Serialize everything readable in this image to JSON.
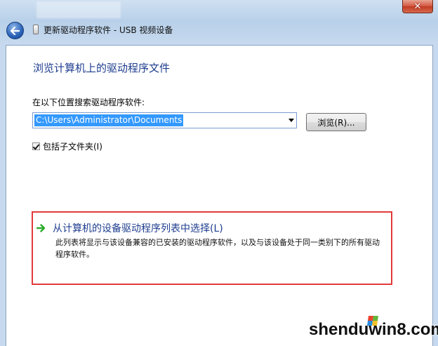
{
  "window": {
    "title": "更新驱动程序软件 - USB 视频设备",
    "close_symbol": "✕"
  },
  "icons": {
    "back": "back-arrow-icon",
    "device": "usb-device-icon",
    "choose": "green-arrow-icon"
  },
  "content": {
    "heading": "浏览计算机上的驱动程序文件",
    "search_label": "在以下位置搜索驱动程序软件:",
    "path_value": "C:\\Users\\Administrator\\Documents",
    "browse_label": "浏览(R)...",
    "include_subfolders_label": "包括子文件夹(I)",
    "include_subfolders_checked": true,
    "choose_link": "从计算机的设备驱动程序列表中选择(L)",
    "choose_desc": "此列表将显示与该设备兼容的已安装的驱动程序软件，以及与该设备处于同一类别下的所有驱动程序软件。"
  },
  "colors": {
    "link_blue": "#1e3d8f",
    "highlight_red": "#e23a3a",
    "selection_blue": "#3399ff",
    "arrow_green": "#2eab2e"
  },
  "watermark": {
    "text": "shenduwin8.com"
  }
}
